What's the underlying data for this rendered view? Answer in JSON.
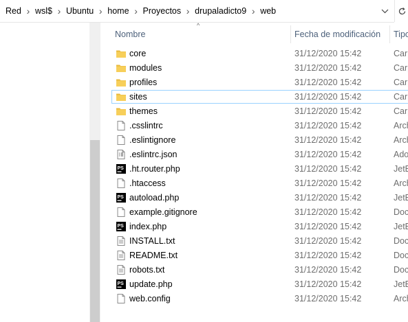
{
  "breadcrumb": [
    "Red",
    "wsl$",
    "Ubuntu",
    "home",
    "Proyectos",
    "drupaladicto9",
    "web"
  ],
  "columns": {
    "name": "Nombre",
    "date": "Fecha de modificación",
    "type": "Tipo"
  },
  "colors": {
    "header_text": "#4c607a",
    "selection_border": "#99d1ff",
    "folder": "#f7cf5a",
    "phpstorm_bg": "#000000"
  },
  "files": [
    {
      "name": "core",
      "date": "31/12/2020 15:42",
      "type": "Carp",
      "icon": "folder-icon"
    },
    {
      "name": "modules",
      "date": "31/12/2020 15:42",
      "type": "Carp",
      "icon": "folder-icon"
    },
    {
      "name": "profiles",
      "date": "31/12/2020 15:42",
      "type": "Carp",
      "icon": "folder-icon"
    },
    {
      "name": "sites",
      "date": "31/12/2020 15:42",
      "type": "Carp",
      "icon": "folder-icon",
      "selected": true
    },
    {
      "name": "themes",
      "date": "31/12/2020 15:42",
      "type": "Carp",
      "icon": "folder-icon"
    },
    {
      "name": ".csslintrc",
      "date": "31/12/2020 15:42",
      "type": "Arch",
      "icon": "file-icon"
    },
    {
      "name": ".eslintignore",
      "date": "31/12/2020 15:42",
      "type": "Arch",
      "icon": "file-icon"
    },
    {
      "name": ".eslintrc.json",
      "date": "31/12/2020 15:42",
      "type": "Ado",
      "icon": "json-file-icon"
    },
    {
      "name": ".ht.router.php",
      "date": "31/12/2020 15:42",
      "type": "JetB",
      "icon": "phpstorm-file-icon"
    },
    {
      "name": ".htaccess",
      "date": "31/12/2020 15:42",
      "type": "Arch",
      "icon": "file-icon"
    },
    {
      "name": "autoload.php",
      "date": "31/12/2020 15:42",
      "type": "JetB",
      "icon": "phpstorm-file-icon"
    },
    {
      "name": "example.gitignore",
      "date": "31/12/2020 15:42",
      "type": "Doc",
      "icon": "file-icon"
    },
    {
      "name": "index.php",
      "date": "31/12/2020 15:42",
      "type": "JetB",
      "icon": "phpstorm-file-icon"
    },
    {
      "name": "INSTALL.txt",
      "date": "31/12/2020 15:42",
      "type": "Doc",
      "icon": "text-file-icon"
    },
    {
      "name": "README.txt",
      "date": "31/12/2020 15:42",
      "type": "Doc",
      "icon": "text-file-icon"
    },
    {
      "name": "robots.txt",
      "date": "31/12/2020 15:42",
      "type": "Doc",
      "icon": "text-file-icon"
    },
    {
      "name": "update.php",
      "date": "31/12/2020 15:42",
      "type": "JetB",
      "icon": "phpstorm-file-icon"
    },
    {
      "name": "web.config",
      "date": "31/12/2020 15:42",
      "type": "Arch",
      "icon": "file-icon"
    }
  ]
}
